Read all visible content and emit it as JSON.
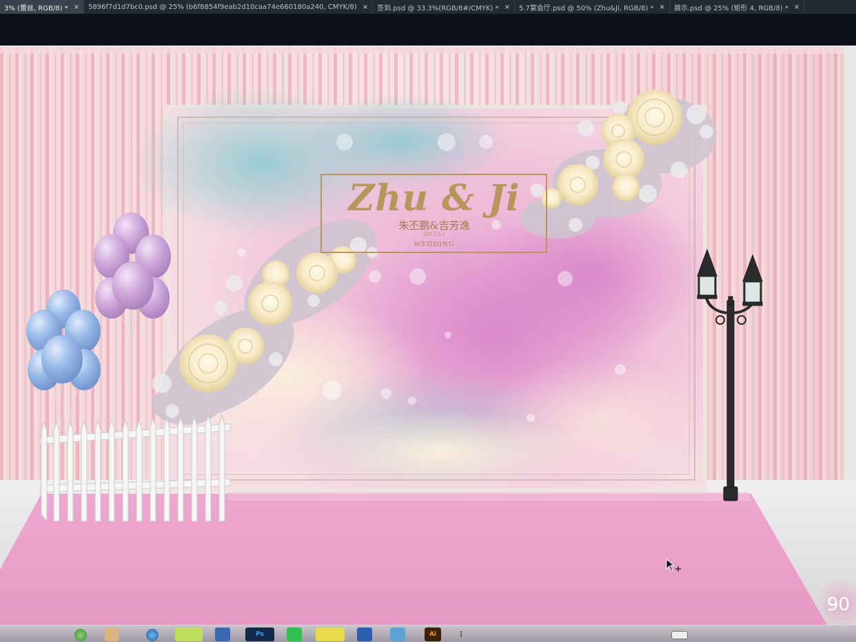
{
  "tabs": [
    {
      "label": "3% (蕾丝, RGB/8) *",
      "active": true
    },
    {
      "label": "5896f7d1d7bc0.psd @ 25% (b6f8854f9eab2d10caa74e660180a240, CMYK/8)",
      "active": false
    },
    {
      "label": "签到.psd @ 33.3%(RGB/8#/CMYK) *",
      "active": false
    },
    {
      "label": "5.7宴会厅.psd @ 50% (Zhu&Ji, RGB/8) *",
      "active": false
    },
    {
      "label": "展示.psd @ 25% (矩形 4, RGB/8) *",
      "active": false
    }
  ],
  "tab_close_glyph": "×",
  "sign": {
    "names_en": "Zhu & Ji",
    "names_cn": "朱丕鹏&吉芳逸",
    "date": "2017.5.1",
    "wedding": "WEDDING"
  },
  "zoom_badge": "90",
  "taskbar_labels": {
    "ps": "Ps",
    "ai": "Ai"
  },
  "colors": {
    "curtain": "#f1c9cf",
    "carpet": "#e9a3cc",
    "gold": "#b8955a",
    "tabbar": "#242a33",
    "balloon_purple": "#c8a0d6",
    "balloon_blue": "#8fb1e4"
  },
  "icons": [
    "cursor-arrow-icon",
    "tab-close-icon",
    "keyboard-icon",
    "photoshop-icon",
    "illustrator-icon"
  ]
}
